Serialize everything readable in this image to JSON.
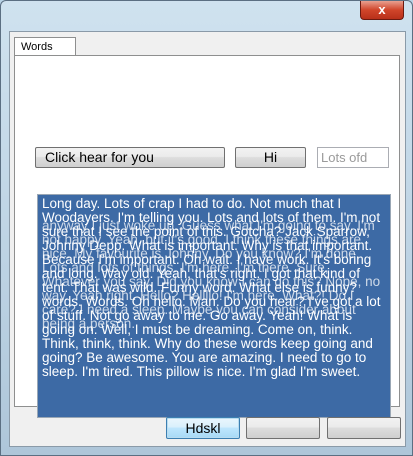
{
  "window": {
    "close_label": "x"
  },
  "tabs": [
    {
      "label": "Words"
    }
  ],
  "controls": {
    "click_button_label": "Click hear for you",
    "hi_button_label": "Hi",
    "lots_field_value": "Lots ofd"
  },
  "textbox": {
    "text": "Long day. Lots of crap I had to do. Not much that I Woodayers. I'm telling you. Lots and lots of them. I'm not sure that I see the point of this. Gotcha? Jack Sparrow, Johnny Depp. What is important. Why is that important. Because I'm important. Oh wait. I have work. It's boring and long. Way old. Yeah, that's right. I got that kind of tent. That was wild. Funny word. What else is funny? words. Words. Oh hello. Man. Do you hear? I've got a lot of stuff. Not go away to me. Go away. Yeah! What is going on. Well, I must be dreaming. Come on, think. Think, think, think. Why do these words keep going and going? Be awesome. You are amazing. I need to go to sleep. I'm tired. This pillow is nice. I'm glad I'm sweet.",
    "overlay_text": "anyway I just woke up. Guess what I'm going to say. I'm not happy. Yeah, but it's good. I think these things are nice. My favourite is Johnny. Do you know? I'm done. Lots and lots of things. I'm here. I'm there. Sure, Whatever you say. Did you know I can do this? Nope, no way. Yeah right. Hello? Hellllo! I'm here. What?! Do I care? I need a sleep. Maybe you can consider about being a person."
  },
  "bottom_buttons": {
    "primary_label": "Hdskl",
    "second_label": "",
    "third_label": ""
  }
}
